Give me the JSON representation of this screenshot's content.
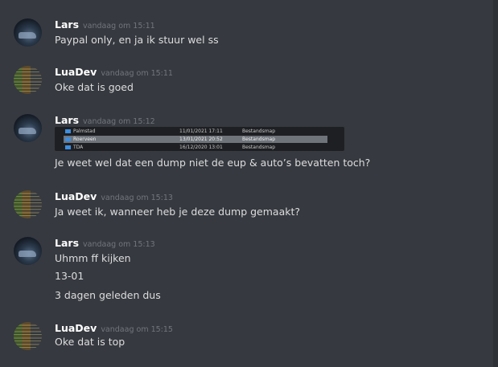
{
  "messages": [
    {
      "author": "Lars",
      "time": "vandaag om 15:11",
      "lines": [
        "Paypal only, en ja ik stuur wel ss"
      ]
    },
    {
      "author": "LuaDev",
      "time": "vandaag om 15:11",
      "lines": [
        "Oke dat is goed"
      ]
    },
    {
      "author": "Lars",
      "time": "vandaag om 15:12",
      "lines": [
        "Je weet wel dat een dump niet de eup & auto’s bevatten toch?"
      ],
      "attachment": {
        "rows": [
          {
            "name": "Palmstad",
            "date": "11/01/2021 17:11",
            "type": "Bestandsmap"
          },
          {
            "name": "Roerveen",
            "date": "13/01/2021 20:52",
            "type": "Bestandsmap"
          },
          {
            "name": "TDA",
            "date": "16/12/2020 13:01",
            "type": "Bestandsmap"
          }
        ]
      }
    },
    {
      "author": "LuaDev",
      "time": "vandaag om 15:13",
      "lines": [
        "Ja weet ik, wanneer heb je deze dump gemaakt?"
      ]
    },
    {
      "author": "Lars",
      "time": "vandaag om 15:13",
      "lines": [
        "Uhmm ff kijken",
        "13-01",
        "3 dagen geleden dus"
      ]
    },
    {
      "author": "LuaDev",
      "time": "vandaag om 15:15",
      "lines": [
        "Oke dat is top"
      ]
    }
  ],
  "icons": {
    "folder": "folder-icon",
    "avatar_lars": "avatar-car",
    "avatar_luadev": "avatar-code"
  },
  "colors": {
    "background": "#36393f",
    "text": "#dcddde",
    "author": "#ffffff",
    "timestamp": "#72767d",
    "folder": "#3c8ee0"
  }
}
